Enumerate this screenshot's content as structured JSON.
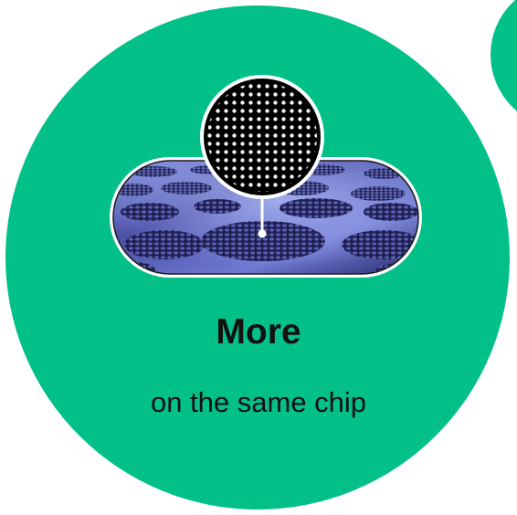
{
  "colors": {
    "accent_green": "#02c088",
    "background": "#ffffff",
    "text": "#111111"
  },
  "headline": "More",
  "subline": "on the same chip",
  "icons": {
    "zoom_lens": "magnified-pillar-array-icon",
    "chip_panel": "metasurface-chip-icon"
  }
}
